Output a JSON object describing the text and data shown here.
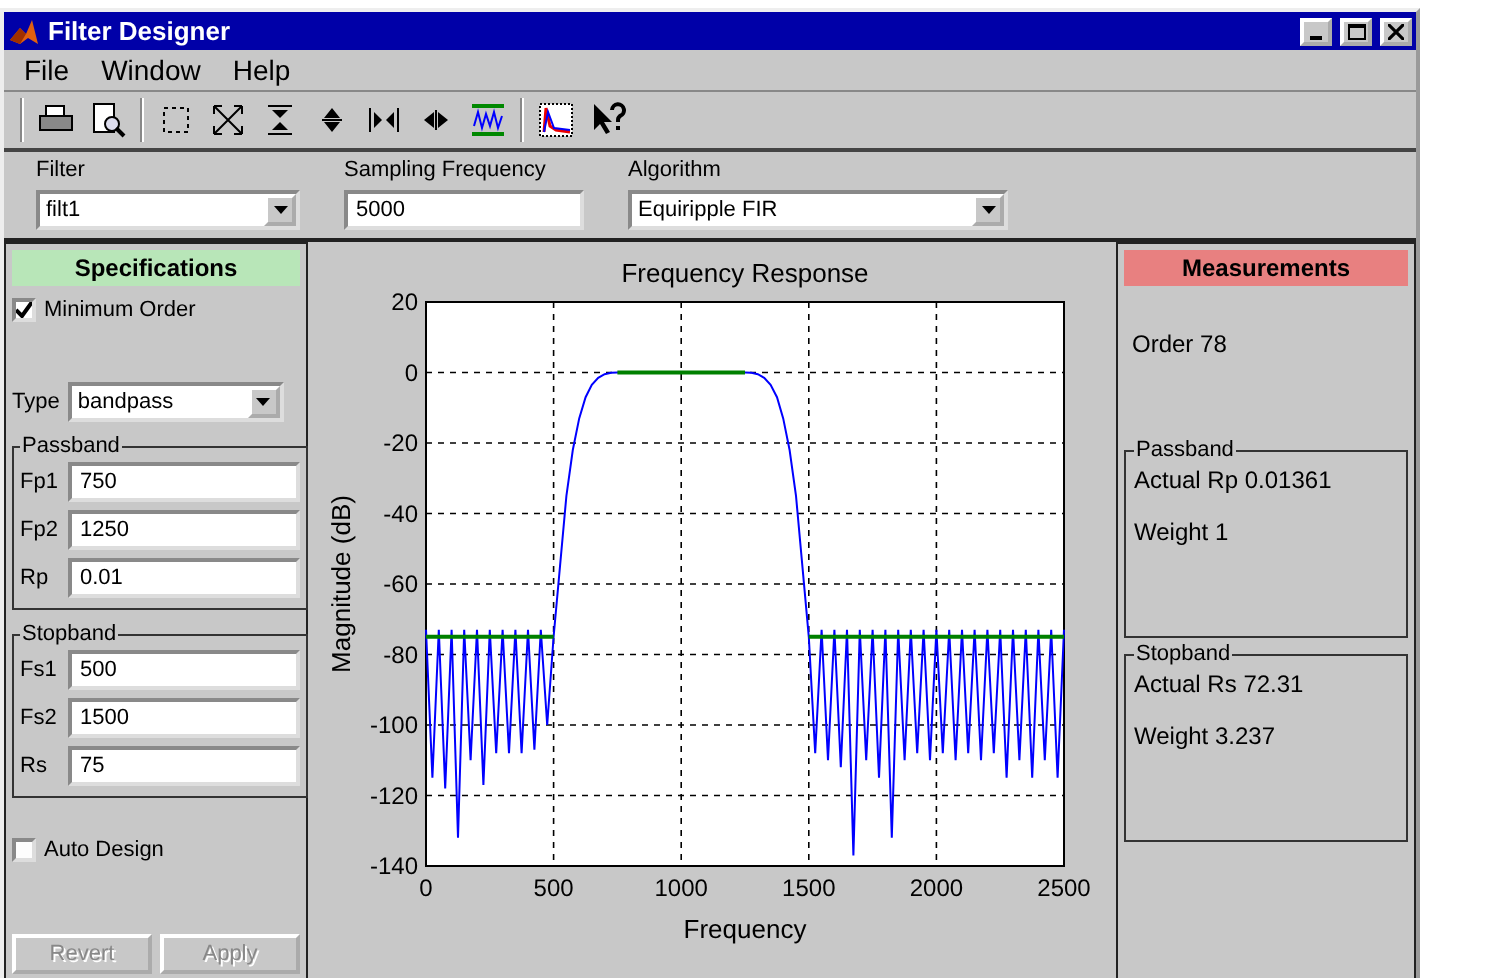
{
  "window": {
    "title": "Filter Designer"
  },
  "menu": [
    "File",
    "Window",
    "Help"
  ],
  "top_controls": {
    "filter": {
      "label": "Filter",
      "value": "filt1"
    },
    "sampling_frequency": {
      "label": "Sampling Frequency",
      "value": "5000"
    },
    "algorithm": {
      "label": "Algorithm",
      "value": "Equiripple FIR"
    }
  },
  "specifications": {
    "title": "Specifications",
    "minimum_order": {
      "label": "Minimum Order",
      "checked": true
    },
    "type": {
      "label": "Type",
      "value": "bandpass"
    },
    "groups": [
      {
        "title": "Passband",
        "fields": [
          {
            "label": "Fp1",
            "value": "750"
          },
          {
            "label": "Fp2",
            "value": "1250"
          },
          {
            "label": "Rp",
            "value": "0.01"
          }
        ]
      },
      {
        "title": "Stopband",
        "fields": [
          {
            "label": "Fs1",
            "value": "500"
          },
          {
            "label": "Fs2",
            "value": "1500"
          },
          {
            "label": "Rs",
            "value": "75"
          }
        ]
      }
    ],
    "auto_design": {
      "label": "Auto Design",
      "checked": false
    },
    "buttons": [
      {
        "label": "Revert",
        "disabled": true
      },
      {
        "label": "Apply",
        "disabled": true
      }
    ]
  },
  "plot": {
    "chart_data": {
      "type": "line",
      "grid": true,
      "title": "Frequency Response",
      "xlabel": "Frequency",
      "ylabel": "Magnitude (dB)",
      "xlim": [
        0,
        2500
      ],
      "ylim": [
        -140,
        20
      ],
      "xticks": [
        0,
        500,
        1000,
        1500,
        2000,
        2500
      ],
      "yticks": [
        20,
        0,
        -20,
        -40,
        -60,
        -80,
        -100,
        -120,
        -140
      ],
      "x": [
        0,
        25,
        50,
        75,
        100,
        125,
        150,
        175,
        200,
        225,
        250,
        275,
        300,
        325,
        350,
        375,
        400,
        425,
        450,
        475,
        500,
        525,
        550,
        575,
        600,
        625,
        650,
        675,
        700,
        725,
        750,
        775,
        800,
        825,
        850,
        875,
        900,
        925,
        950,
        975,
        1000,
        1025,
        1050,
        1075,
        1100,
        1125,
        1150,
        1175,
        1200,
        1225,
        1250,
        1275,
        1300,
        1325,
        1350,
        1375,
        1400,
        1425,
        1450,
        1475,
        1500,
        1525,
        1550,
        1575,
        1600,
        1625,
        1650,
        1675,
        1700,
        1725,
        1750,
        1775,
        1800,
        1825,
        1850,
        1875,
        1900,
        1925,
        1950,
        1975,
        2000,
        2025,
        2050,
        2075,
        2100,
        2125,
        2150,
        2175,
        2200,
        2225,
        2250,
        2275,
        2300,
        2325,
        2350,
        2375,
        2400,
        2425,
        2450,
        2475,
        2500
      ],
      "series": [
        {
          "color": "#0000ff",
          "values": [
            -73,
            -115,
            -73,
            -118,
            -73,
            -132,
            -73,
            -110,
            -73,
            -117,
            -73,
            -108,
            -73,
            -108,
            -73,
            -108,
            -73,
            -107,
            -73,
            -100,
            -75,
            -55,
            -35,
            -22,
            -13,
            -7,
            -3.5,
            -1.5,
            -0.5,
            -0.1,
            0,
            0,
            0,
            0,
            0,
            0,
            0,
            0,
            0,
            0,
            0,
            0,
            0,
            0,
            0,
            0,
            0,
            0,
            0,
            0,
            0,
            -0.1,
            -0.5,
            -1.5,
            -3.5,
            -7,
            -13,
            -22,
            -35,
            -55,
            -75,
            -108,
            -73,
            -110,
            -73,
            -112,
            -73,
            -137,
            -73,
            -110,
            -73,
            -115,
            -73,
            -132,
            -73,
            -110,
            -73,
            -108,
            -73,
            -110,
            -73,
            -108,
            -73,
            -110,
            -73,
            -108,
            -73,
            -110,
            -73,
            -108,
            -73,
            -115,
            -73,
            -110,
            -73,
            -115,
            -73,
            -110,
            -73,
            -115,
            -73
          ]
        },
        {
          "color": "#008000",
          "values": [
            -75,
            -75,
            -75,
            -75,
            -75,
            -75,
            -75,
            -75,
            -75,
            -75,
            -75,
            -75,
            -75,
            -75,
            -75,
            -75,
            -75,
            -75,
            -75,
            -75,
            -75,
            null,
            null,
            null,
            null,
            null,
            null,
            null,
            null,
            null,
            0,
            0,
            0,
            0,
            0,
            0,
            0,
            0,
            0,
            0,
            0,
            0,
            0,
            0,
            0,
            0,
            0,
            0,
            0,
            0,
            0,
            null,
            null,
            null,
            null,
            null,
            null,
            null,
            null,
            null,
            -75,
            -75,
            -75,
            -75,
            -75,
            -75,
            -75,
            -75,
            -75,
            -75,
            -75,
            -75,
            -75,
            -75,
            -75,
            -75,
            -75,
            -75,
            -75,
            -75,
            -75,
            -75,
            -75,
            -75,
            -75,
            -75,
            -75,
            -75,
            -75,
            -75,
            -75,
            -75,
            -75,
            -75,
            -75,
            -75,
            -75,
            -75,
            -75,
            -75,
            -75
          ]
        }
      ]
    }
  },
  "measurements": {
    "title": "Measurements",
    "order": {
      "label": "Order",
      "value": "78"
    },
    "groups": [
      {
        "title": "Passband",
        "rows": [
          {
            "label": "Actual Rp",
            "value": "0.01361"
          },
          {
            "label": "Weight",
            "value": "1"
          }
        ]
      },
      {
        "title": "Stopband",
        "rows": [
          {
            "label": "Actual Rs",
            "value": "72.31"
          },
          {
            "label": "Weight",
            "value": "3.237"
          }
        ]
      }
    ]
  }
}
